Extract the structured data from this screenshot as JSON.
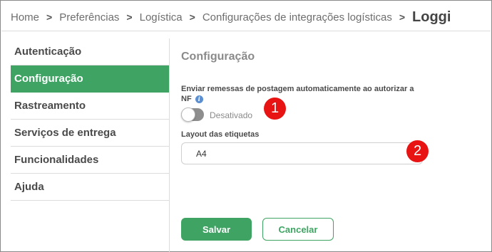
{
  "breadcrumb": {
    "items": [
      "Home",
      "Preferências",
      "Logística",
      "Configurações de integrações logísticas"
    ],
    "current": "Loggi",
    "separator": ">"
  },
  "sidebar": {
    "items": [
      {
        "label": "Autenticação",
        "active": false
      },
      {
        "label": "Configuração",
        "active": true
      },
      {
        "label": "Rastreamento",
        "active": false
      },
      {
        "label": "Serviços de entrega",
        "active": false
      },
      {
        "label": "Funcionalidades",
        "active": false
      },
      {
        "label": "Ajuda",
        "active": false
      }
    ]
  },
  "main": {
    "title": "Configuração",
    "auto_send": {
      "label": "Enviar remessas de postagem automaticamente ao autorizar a NF",
      "info_icon": "info-icon",
      "info_glyph": "i",
      "toggle_state": "Desativado",
      "enabled": false
    },
    "layout": {
      "label": "Layout das etiquetas",
      "value": "A4"
    },
    "callouts": [
      "1",
      "2"
    ],
    "buttons": {
      "save": "Salvar",
      "cancel": "Cancelar"
    }
  },
  "colors": {
    "accent": "#3fa463",
    "callout": "#e81414",
    "info": "#5b8fd1",
    "toggle_off": "#8e8e8e"
  }
}
